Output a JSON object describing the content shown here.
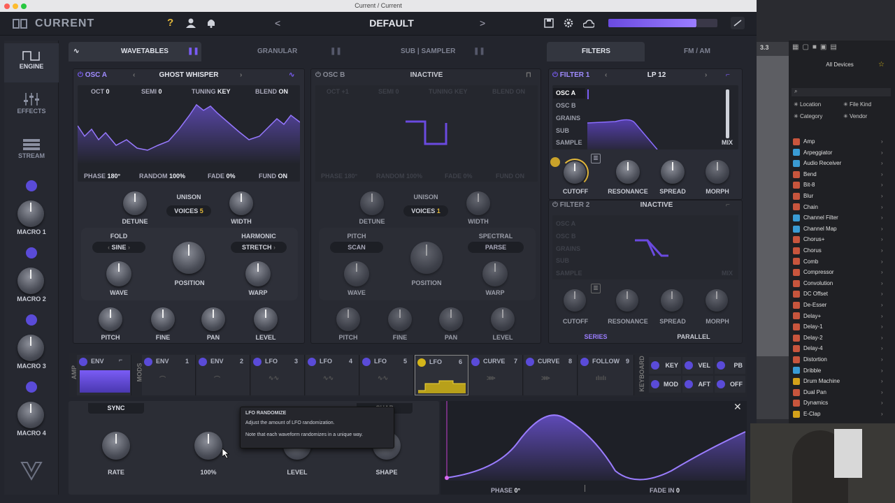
{
  "window": {
    "title": "Current / Current"
  },
  "header": {
    "logo": "CURRENT",
    "preset": "DEFAULT",
    "help": "?",
    "prev": "<",
    "next": ">"
  },
  "sidebar": {
    "items": [
      {
        "label": "ENGINE"
      },
      {
        "label": "EFFECTS"
      },
      {
        "label": "STREAM"
      }
    ],
    "macros": [
      "MACRO 1",
      "MACRO 2",
      "MACRO 3",
      "MACRO 4"
    ]
  },
  "tabs": {
    "wavetables": "WAVETABLES",
    "granular": "GRANULAR",
    "sub_sampler": "SUB | SAMPLER",
    "filters": "FILTERS",
    "fm_am": "FM / AM"
  },
  "osc_a": {
    "title": "OSC A",
    "wave": "GHOST WHISPER",
    "oct_l": "OCT",
    "oct": "0",
    "semi_l": "SEMI",
    "semi": "0",
    "tuning_l": "TUNING",
    "tuning": "KEY",
    "blend_l": "BLEND",
    "blend": "ON",
    "phase_l": "PHASE",
    "phase": "180°",
    "random_l": "RANDOM",
    "random": "100%",
    "fade_l": "FADE",
    "fade": "0%",
    "fund_l": "FUND",
    "fund": "ON",
    "detune": "DETUNE",
    "unison": "UNISON",
    "voices_l": "VOICES",
    "voices": "5",
    "width": "WIDTH",
    "fold": "FOLD",
    "fold_val": "SINE",
    "harmonic": "HARMONIC",
    "harmonic_val": "STRETCH",
    "wave_l": "WAVE",
    "position": "POSITION",
    "warp": "WARP",
    "pitch": "PITCH",
    "fine": "FINE",
    "pan": "PAN",
    "level": "LEVEL"
  },
  "osc_b": {
    "title": "OSC B",
    "wave": "INACTIVE",
    "oct_l": "OCT",
    "oct": "+1",
    "semi_l": "SEMI",
    "semi": "0",
    "tuning_l": "TUNING",
    "tuning": "KEY",
    "blend_l": "BLEND",
    "blend": "ON",
    "phase_l": "PHASE",
    "phase": "180°",
    "random_l": "RANDOM",
    "random": "100%",
    "fade_l": "FADE",
    "fade": "0%",
    "fund_l": "FUND",
    "fund": "ON",
    "detune": "DETUNE",
    "unison": "UNISON",
    "voices_l": "VOICES",
    "voices": "1",
    "width": "WIDTH",
    "pitch_mode": "PITCH",
    "pitch_mode_val": "SCAN",
    "spectral": "SPECTRAL",
    "spectral_val": "PARSE",
    "wave_l": "WAVE",
    "position": "POSITION",
    "warp": "WARP",
    "pitch": "PITCH",
    "fine": "FINE",
    "pan": "PAN",
    "level": "LEVEL"
  },
  "filter1": {
    "title": "FILTER 1",
    "type": "LP 12",
    "sources": [
      "OSC A",
      "OSC B",
      "GRAINS",
      "SUB",
      "SAMPLE"
    ],
    "mix": "MIX",
    "cutoff": "CUTOFF",
    "resonance": "RESONANCE",
    "spread": "SPREAD",
    "morph": "MORPH"
  },
  "filter2": {
    "title": "FILTER 2",
    "type": "INACTIVE",
    "sources": [
      "OSC A",
      "OSC B",
      "GRAINS",
      "SUB",
      "SAMPLE"
    ],
    "mix": "MIX",
    "cutoff": "CUTOFF",
    "resonance": "RESONANCE",
    "spread": "SPREAD",
    "morph": "MORPH",
    "series": "SERIES",
    "parallel": "PARALLEL"
  },
  "mods": {
    "amp_l": "AMP",
    "mods_l": "MODS",
    "keyboard_l": "KEYBOARD",
    "slots": [
      {
        "name": "ENV",
        "num": ""
      },
      {
        "name": "ENV",
        "num": "1"
      },
      {
        "name": "ENV",
        "num": "2"
      },
      {
        "name": "LFO",
        "num": "3"
      },
      {
        "name": "LFO",
        "num": "4"
      },
      {
        "name": "LFO",
        "num": "5"
      },
      {
        "name": "LFO",
        "num": "6"
      },
      {
        "name": "CURVE",
        "num": "7"
      },
      {
        "name": "CURVE",
        "num": "8"
      },
      {
        "name": "FOLLOW",
        "num": "9"
      }
    ],
    "keys": [
      "KEY",
      "VEL",
      "PB",
      "MOD",
      "AFT",
      "OFF"
    ]
  },
  "lfo": {
    "sync": "SYNC",
    "shape_hdr": "SHAP",
    "rate": "RATE",
    "random_val": "100%",
    "level": "LEVEL",
    "shape": "SHAPE",
    "phase_l": "PHASE",
    "phase": "0°",
    "fadein_l": "FADE IN",
    "fadein": "0",
    "close": "✕"
  },
  "tooltip": {
    "title": "LFO RANDOMIZE",
    "line1": "Adjust the amount of LFO randomization.",
    "line2": "Note that each waveform randomizes in a unique way."
  },
  "daw": {
    "counter": "3.3",
    "browser_title": "All Devices",
    "location": "Location",
    "file_kind": "File Kind",
    "category": "Category",
    "vendor": "Vendor",
    "devices": [
      {
        "name": "Amp",
        "c": "r"
      },
      {
        "name": "Arpeggiator",
        "c": "b"
      },
      {
        "name": "Audio Receiver",
        "c": "b"
      },
      {
        "name": "Bend",
        "c": "r"
      },
      {
        "name": "Bit-8",
        "c": "r"
      },
      {
        "name": "Blur",
        "c": "r"
      },
      {
        "name": "Chain",
        "c": "r"
      },
      {
        "name": "Channel Filter",
        "c": "b"
      },
      {
        "name": "Channel Map",
        "c": "b"
      },
      {
        "name": "Chorus+",
        "c": "r"
      },
      {
        "name": "Chorus",
        "c": "r"
      },
      {
        "name": "Comb",
        "c": "r"
      },
      {
        "name": "Compressor",
        "c": "r"
      },
      {
        "name": "Convolution",
        "c": "r"
      },
      {
        "name": "DC Offset",
        "c": "r"
      },
      {
        "name": "De-Esser",
        "c": "r"
      },
      {
        "name": "Delay+",
        "c": "r"
      },
      {
        "name": "Delay-1",
        "c": "r"
      },
      {
        "name": "Delay-2",
        "c": "r"
      },
      {
        "name": "Delay-4",
        "c": "r"
      },
      {
        "name": "Distortion",
        "c": "r"
      },
      {
        "name": "Dribble",
        "c": "b"
      },
      {
        "name": "Drum Machine",
        "c": "y"
      },
      {
        "name": "Dual Pan",
        "c": "r"
      },
      {
        "name": "Dynamics",
        "c": "r"
      },
      {
        "name": "E-Clap",
        "c": "y"
      }
    ]
  },
  "colors": {
    "accent": "#7a5cf5",
    "lfo_highlight": "#d4b51a",
    "bg": "#23252d"
  }
}
